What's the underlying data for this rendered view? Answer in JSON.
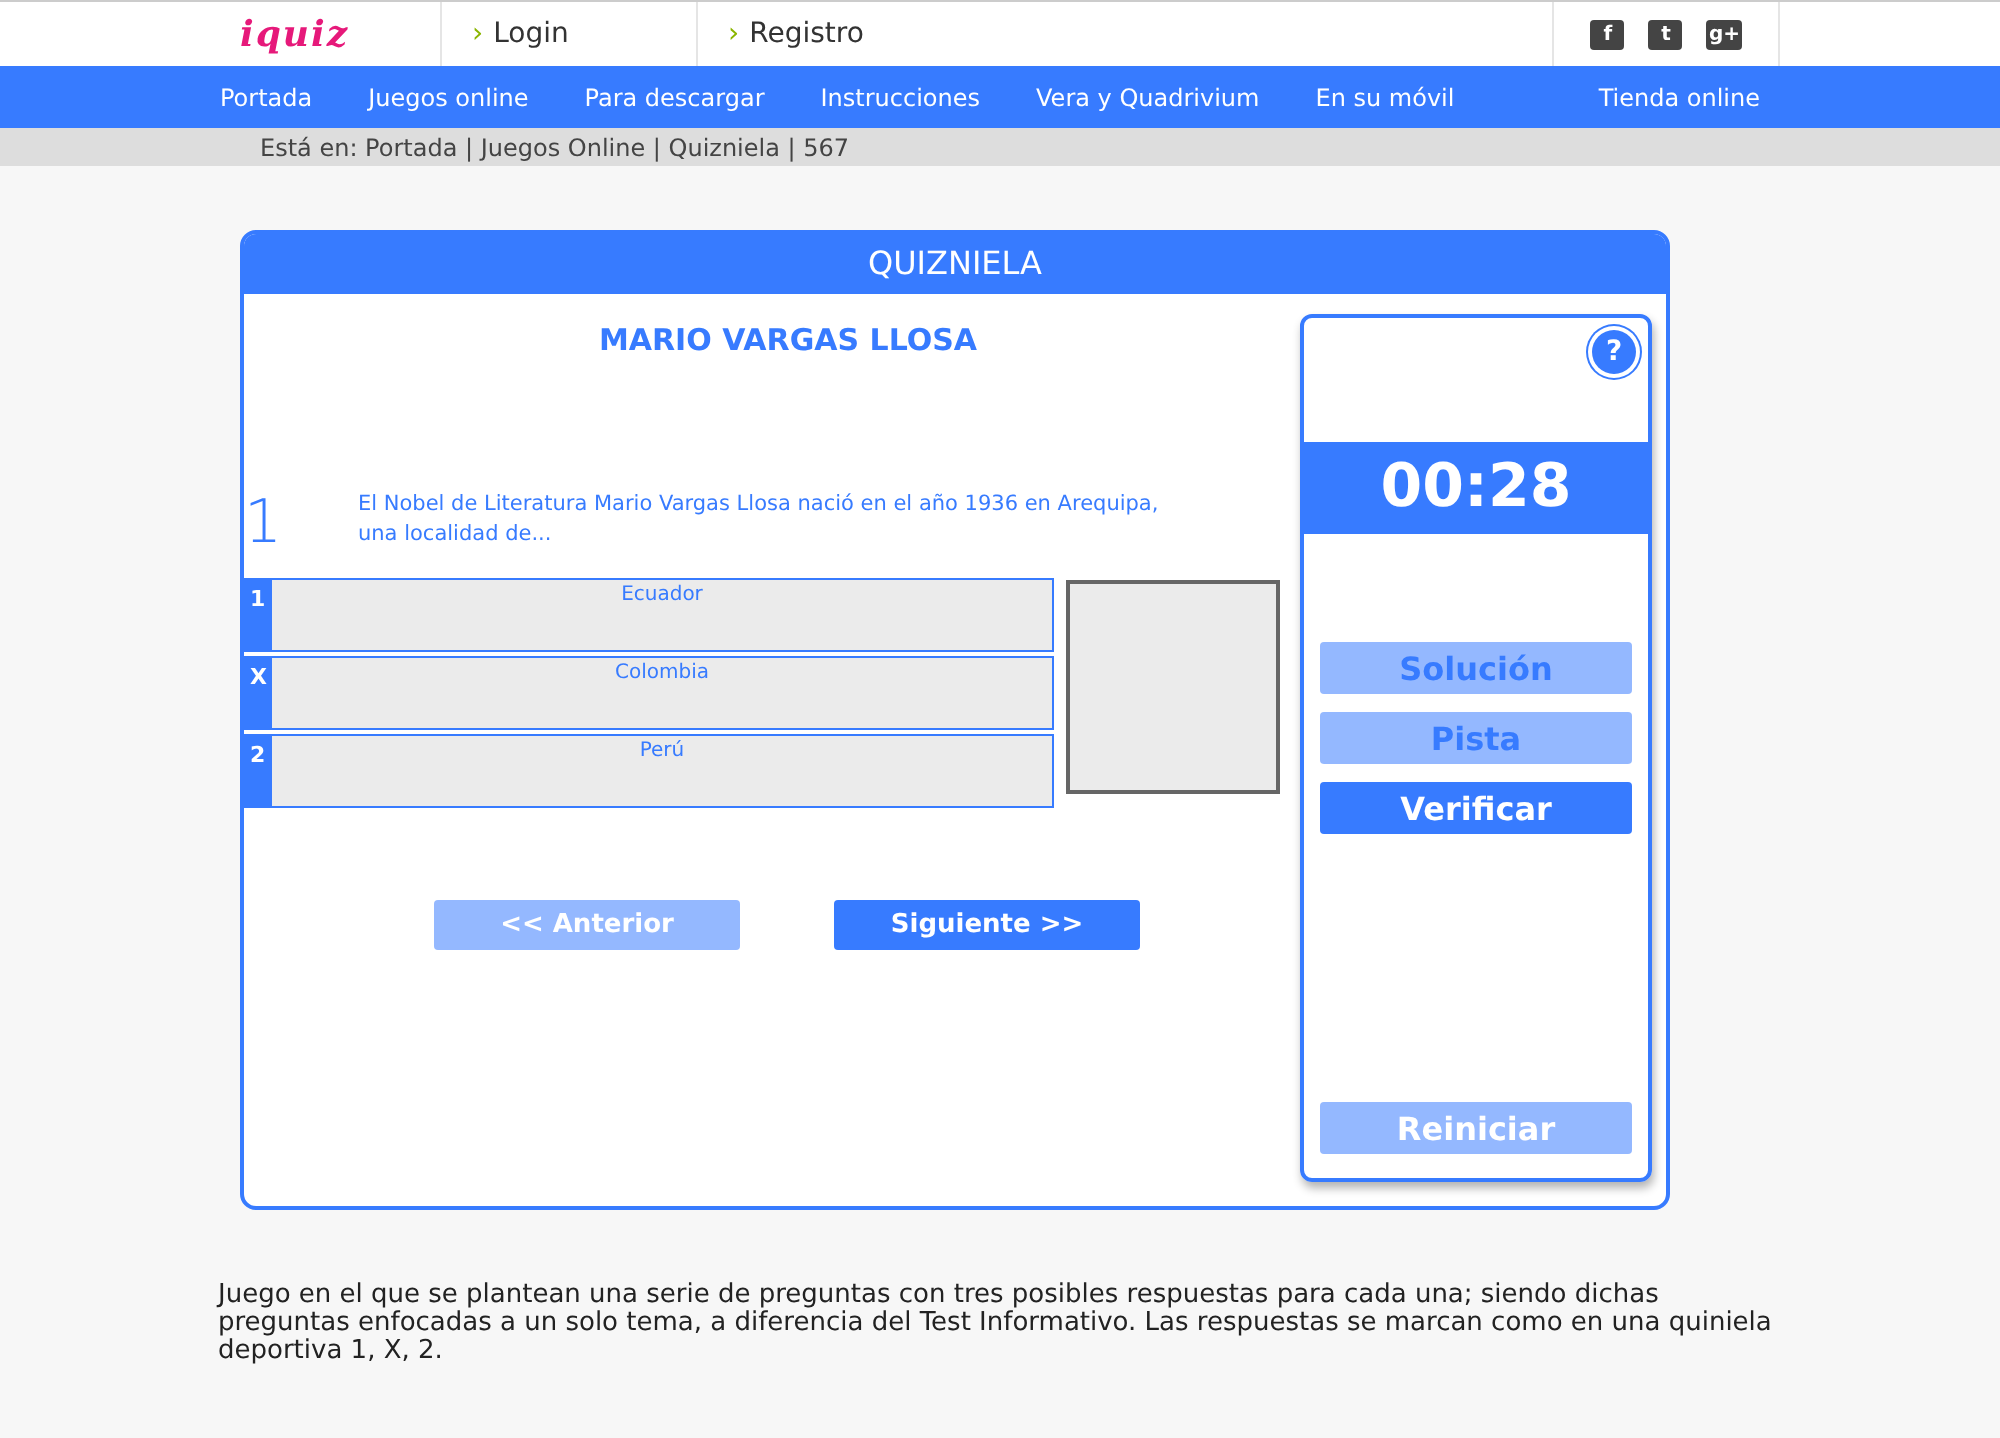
{
  "header": {
    "logo": "iquiz",
    "links": [
      {
        "arrow": "›",
        "label": "Login"
      },
      {
        "arrow": "›",
        "label": "Registro"
      }
    ],
    "social": [
      "f",
      "t",
      "g+"
    ]
  },
  "nav": [
    "Portada",
    "Juegos online",
    "Para descargar",
    "Instrucciones",
    "Vera y Quadrivium",
    "En su móvil",
    "Tienda online"
  ],
  "breadcrumb": "Está en: Portada | Juegos Online | Quizniela | 567",
  "game": {
    "title": "QUIZNIELA",
    "topic": "MARIO VARGAS LLOSA",
    "number": "1",
    "question": "El Nobel de Literatura Mario Vargas Llosa nació en el año 1936 en Arequipa, una localidad de...",
    "answers": [
      {
        "key": "1",
        "text": "Ecuador",
        "selected": false
      },
      {
        "key": "X",
        "text": "Colombia",
        "selected": false
      },
      {
        "key": "2",
        "text": "Perú",
        "selected": false
      }
    ],
    "nav_buttons": [
      {
        "label": "<< Anterior",
        "disabled": true
      },
      {
        "label": "Siguiente >>",
        "disabled": false
      }
    ],
    "help": "?",
    "timer": "00:28",
    "actions": [
      {
        "label": "Solución",
        "disabled": true
      },
      {
        "label": "Pista",
        "disabled": true
      },
      {
        "label": "Verificar",
        "disabled": false
      }
    ],
    "reset": {
      "label": "Reiniciar",
      "disabled": true
    }
  },
  "description": "Juego en el que se plantean una serie de preguntas con tres posibles respuestas para cada una; siendo dichas preguntas enfocadas a un solo tema, a diferencia del Test Informativo. Las respuestas se marcan como en una quiniela deportiva 1, X, 2."
}
